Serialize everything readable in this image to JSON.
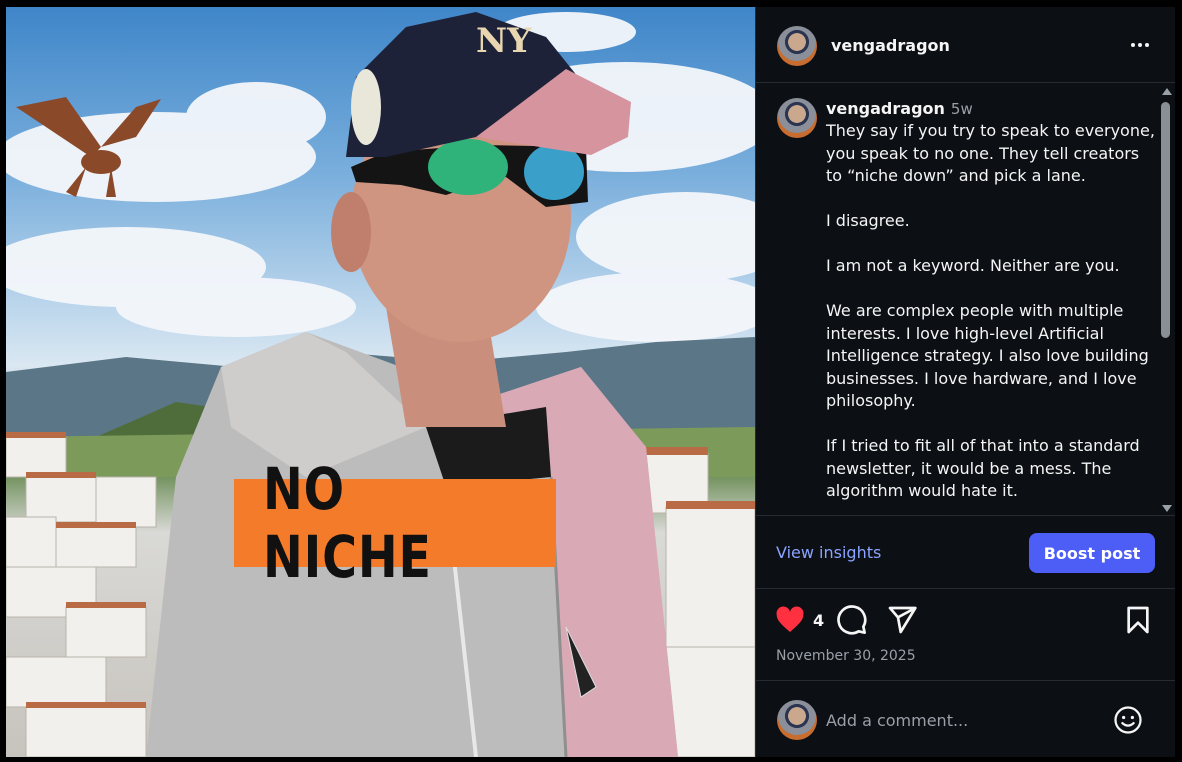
{
  "post": {
    "username": "vengadragon",
    "overlay_text": "NO NICHE",
    "more_icon": "more-horizontal-icon"
  },
  "caption": {
    "username": "vengadragon",
    "time_ago": "5w",
    "lines": [
      "They say if you try to speak to everyone,",
      "you speak to no one. They tell creators",
      "to “niche down” and pick a lane.",
      "",
      "I disagree.",
      "",
      "I am not a keyword. Neither are you.",
      "",
      "We are complex people with multiple",
      "interests. I love high-level Artificial",
      "Intelligence strategy. I also love building",
      "businesses. I love hardware, and I love",
      "philosophy.",
      "",
      "If I tried to fit all of that into a standard",
      "newsletter, it would be a mess. The",
      "algorithm would hate it."
    ]
  },
  "insights": {
    "view_label": "View insights",
    "boost_label": "Boost post"
  },
  "engagement": {
    "like_count": "4",
    "date": "November 30, 2025",
    "liked": true
  },
  "comment": {
    "placeholder": "Add a comment..."
  },
  "colors": {
    "accent": "#4d5ef7",
    "link": "#8aa4ff",
    "like": "#ff3040",
    "banner": "#f47b2a"
  }
}
